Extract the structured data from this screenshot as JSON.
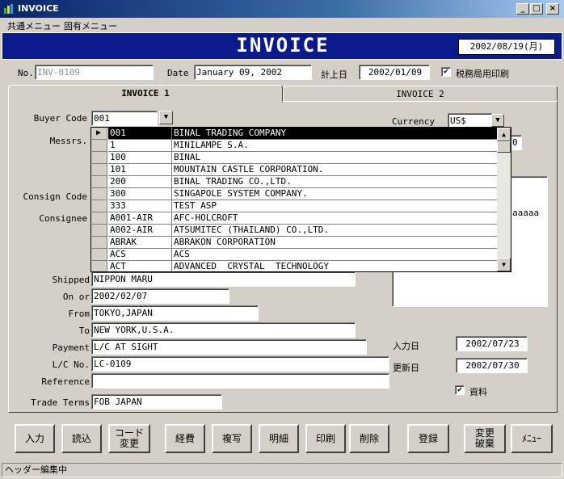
{
  "window": {
    "title": "INVOICE",
    "minimize": "_",
    "maximize": "□",
    "close": "×"
  },
  "menu": [
    "共通メニュー",
    "固有メニュー"
  ],
  "banner": {
    "title": "INVOICE",
    "date": "2002/08/19(月)"
  },
  "header": {
    "no_label": "No.",
    "no_value": "INV-0109",
    "date_label": "Date",
    "date_value": "January 09, 2002",
    "booking_label": "計上日",
    "booking_value": "2002/01/09",
    "tax_check": "✔",
    "tax_label": "税務局用印刷"
  },
  "tabs": [
    "INVOICE 1",
    "INVOICE 2"
  ],
  "form": {
    "buyer_code_label": "Buyer Code",
    "buyer_code_value": "001",
    "messrs_label": "Messrs.",
    "consign_code_label": "Consign Code",
    "consignee_label": "Consignee",
    "currency_label": "Currency",
    "currency_value": "US$",
    "currency_extra": "0",
    "memo_text": "aaaaa",
    "shipped_label": "Shipped",
    "shipped_value": "NIPPON MARU",
    "on_or_label": "On or",
    "on_or_value": "2002/02/07",
    "from_label": "From",
    "from_value": "TOKYO,JAPAN",
    "to_label": "To",
    "to_value": "NEW YORK,U.S.A.",
    "payment_label": "Payment",
    "payment_value": "L/C AT SIGHT",
    "lc_label": "L/C No.",
    "lc_value": "LC-0109",
    "reference_label": "Reference",
    "reference_value": "",
    "trade_terms_label": "Trade Terms",
    "trade_terms_value": "FOB JAPAN",
    "input_date_label": "入力日",
    "input_date_value": "2002/07/23",
    "update_date_label": "更新日",
    "update_date_value": "2002/07/30",
    "material_check": "✔",
    "material_label": "資料"
  },
  "dropdown": {
    "rows": [
      {
        "code": "001",
        "name": "BINAL TRADING COMPANY"
      },
      {
        "code": "1",
        "name": "MINILAMPE S.A."
      },
      {
        "code": "100",
        "name": "BINAL"
      },
      {
        "code": "101",
        "name": "MOUNTAIN CASTLE CORPORATION."
      },
      {
        "code": "200",
        "name": "BINAL TRADING CO.,LTD."
      },
      {
        "code": "300",
        "name": "SINGAPOLE SYSTEM COMPANY."
      },
      {
        "code": "333",
        "name": "TEST ASP"
      },
      {
        "code": "A001-AIR",
        "name": "AFC-HOLCROFT"
      },
      {
        "code": "A002-AIR",
        "name": "ATSUMITEC (THAILAND) CO.,LTD."
      },
      {
        "code": "ABRAK",
        "name": "ABRAKON CORPORATION"
      },
      {
        "code": "ACS",
        "name": "ACS"
      },
      {
        "code": "ACT",
        "name": "ADVANCED  CRYSTAL  TECHNOLOGY"
      }
    ]
  },
  "buttons": [
    "入力",
    "読込",
    "コード\n変更",
    "経費",
    "複写",
    "明細",
    "印刷",
    "削除",
    "登録",
    "変更\n破棄",
    "ﾒﾆｭｰ"
  ],
  "status": "ヘッダー編集中"
}
